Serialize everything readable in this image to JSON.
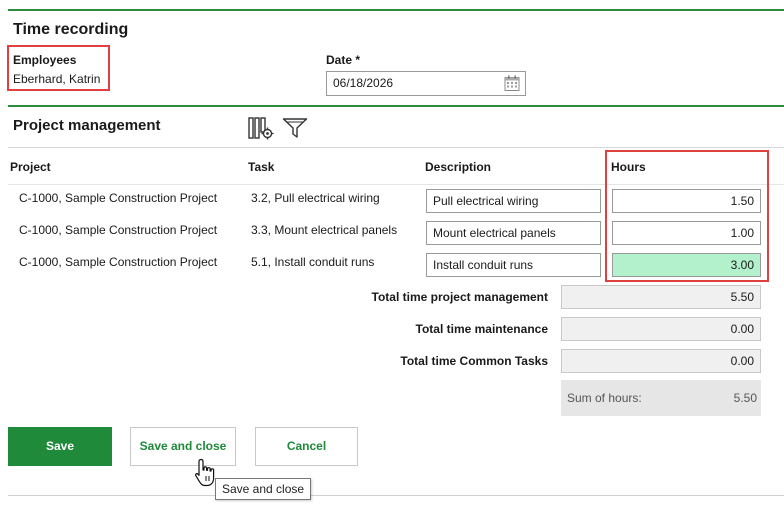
{
  "header": {
    "title": "Time recording"
  },
  "employees": {
    "label": "Employees",
    "value": "Eberhard, Katrin"
  },
  "date": {
    "label": "Date *",
    "value": "06/18/2026",
    "icon": "calendar-icon"
  },
  "section": {
    "title": "Project management",
    "icons": [
      "columns-settings-icon",
      "filter-icon"
    ]
  },
  "table": {
    "columns": [
      "Project",
      "Task",
      "Description",
      "Hours"
    ],
    "rows": [
      {
        "project": "C-1000, Sample Construction Project",
        "task": "3.2, Pull electrical wiring",
        "description": "Pull electrical wiring",
        "hours": "1.50"
      },
      {
        "project": "C-1000, Sample Construction Project",
        "task": "3.3, Mount electrical panels",
        "description": "Mount electrical panels",
        "hours": "1.00"
      },
      {
        "project": "C-1000, Sample Construction Project",
        "task": "5.1, Install conduit runs",
        "description": "Install conduit runs",
        "hours": "3.00"
      }
    ]
  },
  "totals": [
    {
      "label": "Total time project management",
      "value": "5.50"
    },
    {
      "label": "Total time maintenance",
      "value": "0.00"
    },
    {
      "label": "Total time Common Tasks",
      "value": "0.00"
    }
  ],
  "sum": {
    "label": "Sum of hours:",
    "value": "5.50"
  },
  "buttons": {
    "save": "Save",
    "save_close": "Save and close",
    "cancel": "Cancel"
  },
  "tooltip": "Save and close",
  "colors": {
    "accent": "#1f8a3a",
    "highlight": "#e04040",
    "edited": "#b3f0cc"
  }
}
